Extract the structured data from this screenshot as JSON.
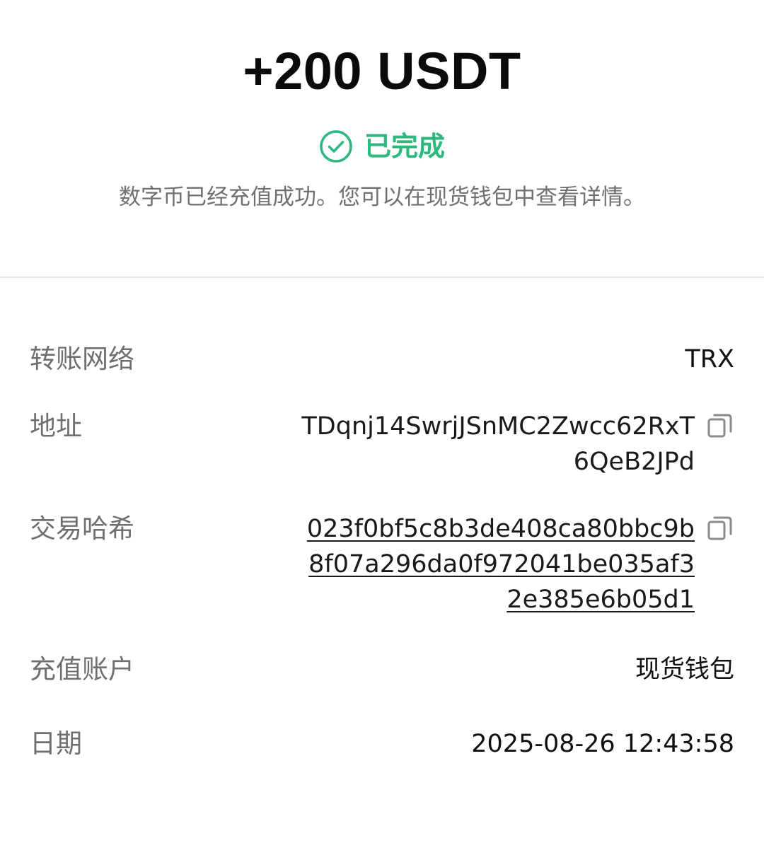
{
  "header": {
    "amount": "+200 USDT",
    "status": "已完成",
    "description": "数字币已经充值成功。您可以在现货钱包中查看详情。",
    "status_icon": "check-circle-icon",
    "status_color": "#2db87d"
  },
  "details": {
    "network": {
      "label": "转账网络",
      "value": "TRX"
    },
    "address": {
      "label": "地址",
      "value": "TDqnj14SwrjJSnMC2Zwcc62RxT6QeB2JPd",
      "copy_icon": "copy-icon"
    },
    "tx_hash": {
      "label": "交易哈希",
      "value": "023f0bf5c8b3de408ca80bbc9b8f07a296da0f972041be035af32e385e6b05d1",
      "copy_icon": "copy-icon"
    },
    "account": {
      "label": "充值账户",
      "value": "现货钱包"
    },
    "date": {
      "label": "日期",
      "value": "2025-08-26 12:43:58"
    }
  }
}
